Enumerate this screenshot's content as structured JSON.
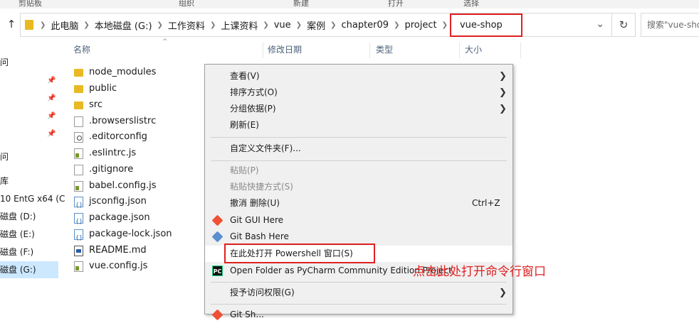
{
  "ribbon": {
    "groups": [
      "剪贴板",
      "组织",
      "新建",
      "打开",
      "选择"
    ]
  },
  "address": {
    "crumbs": [
      "此电脑",
      "本地磁盘 (G:)",
      "工作资料",
      "上课资料",
      "vue",
      "案例",
      "chapter09",
      "project"
    ],
    "current": "vue-shop"
  },
  "search": {
    "placeholder": "搜索\"vue-shop\""
  },
  "nav": {
    "items": [
      "问",
      "问",
      "库",
      "10 EntG x64 (C",
      "磁盘 (D:)",
      "磁盘 (E:)",
      "磁盘 (F:)",
      "磁盘 (G:)"
    ]
  },
  "columns": {
    "name": "名称",
    "modified": "修改日期",
    "type": "类型",
    "size": "大小"
  },
  "files": [
    {
      "name": "node_modules",
      "icon": "folder-icon"
    },
    {
      "name": "public",
      "icon": "folder-icon"
    },
    {
      "name": "src",
      "icon": "folder-icon"
    },
    {
      "name": ".browserslistrc",
      "icon": "doc-icon"
    },
    {
      "name": ".editorconfig",
      "icon": "gear-doc-icon"
    },
    {
      "name": ".eslintrc.js",
      "icon": "js-icon"
    },
    {
      "name": ".gitignore",
      "icon": "doc-icon"
    },
    {
      "name": "babel.config.js",
      "icon": "js-icon"
    },
    {
      "name": "jsconfig.json",
      "icon": "json-icon"
    },
    {
      "name": "package.json",
      "icon": "json-icon"
    },
    {
      "name": "package-lock.json",
      "icon": "json-icon"
    },
    {
      "name": "README.md",
      "icon": "md-icon"
    },
    {
      "name": "vue.config.js",
      "icon": "js-icon"
    }
  ],
  "menu": {
    "view": "查看(V)",
    "sort": "排序方式(O)",
    "group": "分组依据(P)",
    "refresh": "刷新(E)",
    "customize": "自定义文件夹(F)...",
    "paste": "粘贴(P)",
    "paste_shortcut": "粘贴快捷方式(S)",
    "undo": "撤消 删除(U)",
    "undo_shortcut": "Ctrl+Z",
    "git_gui": "Git GUI Here",
    "git_bash": "Git Bash Here",
    "powershell": "在此处打开 Powershell 窗口(S)",
    "pycharm": "Open Folder as PyCharm Community Edition Project",
    "grant_access": "授予访问权限(G)",
    "partial_last": "Git Sh..."
  },
  "annotation": "点击此处打开命令行窗口"
}
